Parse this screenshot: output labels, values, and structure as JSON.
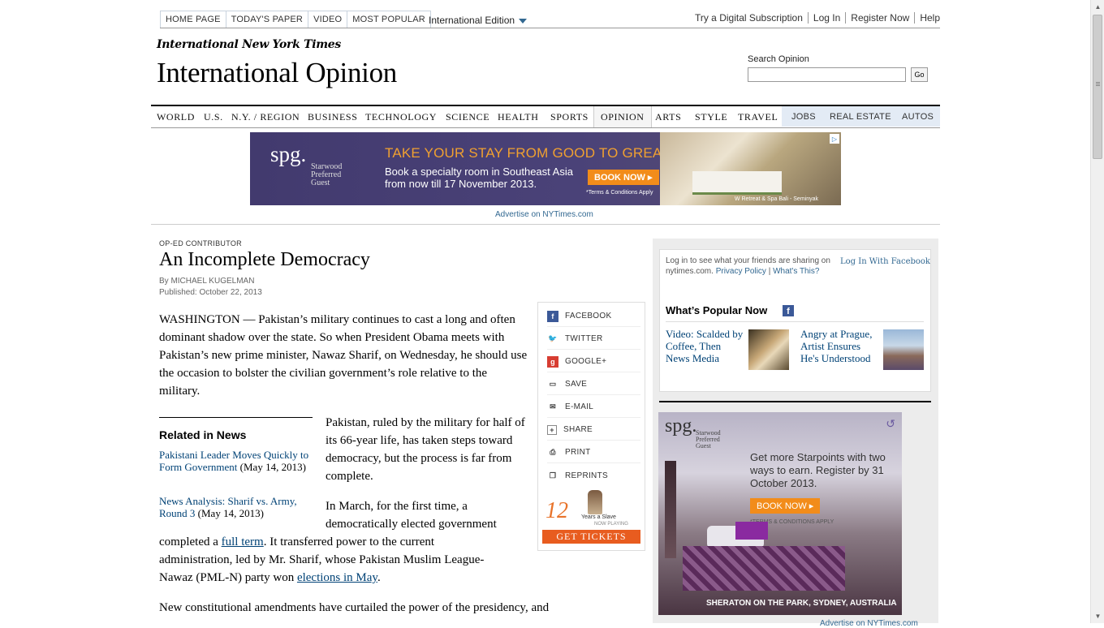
{
  "topnav": {
    "items": [
      "HOME PAGE",
      "TODAY'S PAPER",
      "VIDEO",
      "MOST POPULAR"
    ],
    "edition": "International Edition"
  },
  "toplinks": [
    "Try a Digital Subscription",
    "Log In",
    "Register Now",
    "Help"
  ],
  "masthead": {
    "logo": "International New York Times",
    "section_title": "International Opinion",
    "search_label": "Search Opinion",
    "search_value": "",
    "search_button": "Go"
  },
  "sections": [
    "WORLD",
    "U.S.",
    "N.Y. / REGION",
    "BUSINESS",
    "TECHNOLOGY",
    "SCIENCE",
    "HEALTH",
    "SPORTS",
    "OPINION",
    "ARTS",
    "STYLE",
    "TRAVEL",
    "JOBS",
    "REAL ESTATE",
    "AUTOS"
  ],
  "active_section": "OPINION",
  "banner_ad": {
    "logo": "spg.",
    "logo_sub": "Starwood Preferred Guest",
    "headline": "TAKE YOUR STAY FROM GOOD TO GREAT.",
    "body": "Book a specialty room in Southeast Asia from now till 17 November 2013.",
    "button": "BOOK NOW ▸",
    "terms": "*Terms & Conditions Apply",
    "caption": "W Retreat & Spa Bali - Seminyak",
    "advertise_link": "Advertise on NYTimes.com"
  },
  "article": {
    "kicker": "OP-ED CONTRIBUTOR",
    "headline": "An Incomplete Democracy",
    "byline": "By MICHAEL KUGELMAN",
    "published": "Published: October 22, 2013",
    "p1": "WASHINGTON — Pakistan’s military continues to cast a long and often dominant shadow over the state. So when President Obama meets with Pakistan’s new prime minister, Nawaz Sharif, on Wednesday, he should use the occasion to bolster the civilian government’s role relative to the military.",
    "p2": "Pakistan, ruled by the military for half of its 66-year life, has taken steps toward democracy, but the process is far from complete.",
    "p3_a": "In March, for the first time, a democratically elected government",
    "p3_b1": "completed a ",
    "p3_link1": "full term",
    "p3_b2": ". It transferred power to the current",
    "p3_c": "administration, led by Mr. Sharif, whose Pakistan Muslim League-",
    "p3_d1": "Nawaz (PML-N) party won ",
    "p3_link2": "elections in May",
    "p3_d2": ".",
    "p4": "New constitutional amendments have curtailed the power of the presidency, and"
  },
  "related": {
    "title": "Related in News",
    "items": [
      {
        "link": "Pakistani Leader Moves Quickly to Form Government",
        "date": " (May 14, 2013)"
      },
      {
        "link": "News Analysis: Sharif vs. Army, Round 3",
        "date": " (May 14, 2013)"
      }
    ]
  },
  "share": [
    "FACEBOOK",
    "TWITTER",
    "GOOGLE+",
    "SAVE",
    "E-MAIL",
    "SHARE",
    "PRINT",
    "REPRINTS"
  ],
  "film_ad": {
    "num": "12",
    "text": "Years a Slave",
    "sub": "NOW PLAYING",
    "cta": "GET TICKETS"
  },
  "facebook": {
    "text": "Log in to see what your friends are sharing on nytimes.com.",
    "privacy": "Privacy Policy",
    "whats": "What's This?",
    "login": "Log In With Facebook",
    "popular_title": "What’s Popular Now",
    "popular": [
      "Video: Scalded by Coffee, Then News Media",
      "Angry at Prague, Artist Ensures He's Understood"
    ]
  },
  "rail_ad": {
    "logo": "spg.",
    "logo_sub": "Starwood Preferred Guest",
    "text": "Get more Starpoints with two ways to earn. Register by 31 October 2013.",
    "button": "BOOK NOW ▸",
    "terms": "*TERMS & CONDITIONS APPLY",
    "caption": "SHERATON ON THE PARK, SYDNEY, AUSTRALIA",
    "advertise_link": "Advertise on NYTimes.com"
  }
}
